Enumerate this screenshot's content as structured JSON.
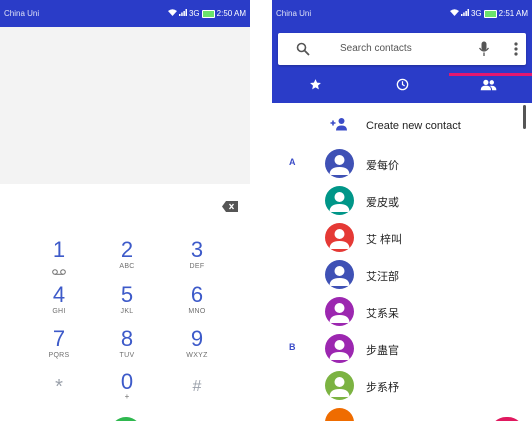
{
  "left_screen": {
    "status": {
      "carrier": "China Uni",
      "network": "3G",
      "time": "2:50 AM"
    },
    "keypad": [
      {
        "digit": "1",
        "letters": "",
        "voicemail": true
      },
      {
        "digit": "2",
        "letters": "ABC"
      },
      {
        "digit": "3",
        "letters": "DEF"
      },
      {
        "digit": "4",
        "letters": "GHI"
      },
      {
        "digit": "5",
        "letters": "JKL"
      },
      {
        "digit": "6",
        "letters": "MNO"
      },
      {
        "digit": "7",
        "letters": "PQRS"
      },
      {
        "digit": "8",
        "letters": "TUV"
      },
      {
        "digit": "9",
        "letters": "WXYZ"
      },
      {
        "digit": "*",
        "letters": ""
      },
      {
        "digit": "0",
        "letters": "+"
      },
      {
        "digit": "#",
        "letters": ""
      }
    ]
  },
  "right_screen": {
    "status": {
      "carrier": "China Uni",
      "network": "3G",
      "time": "2:51 AM"
    },
    "search": {
      "placeholder": "Search contacts"
    },
    "tabs": [
      "favorites",
      "recents",
      "contacts"
    ],
    "create_label": "Create new contact",
    "contacts": [
      {
        "section": "A",
        "name": "爱每价",
        "color": "#3f51b5"
      },
      {
        "section": "",
        "name": "爱皮或",
        "color": "#009688"
      },
      {
        "section": "",
        "name": "艾 梓叫",
        "color": "#e53935"
      },
      {
        "section": "",
        "name": "艾汪部",
        "color": "#3f51b5"
      },
      {
        "section": "",
        "name": "艾系呆",
        "color": "#9c27b0"
      },
      {
        "section": "B",
        "name": "步蛊官",
        "color": "#9c27b0"
      },
      {
        "section": "",
        "name": "步系杼",
        "color": "#7cb342"
      }
    ],
    "colors": {
      "appbar": "#2a3cc8",
      "indicator": "#e3176f"
    }
  }
}
